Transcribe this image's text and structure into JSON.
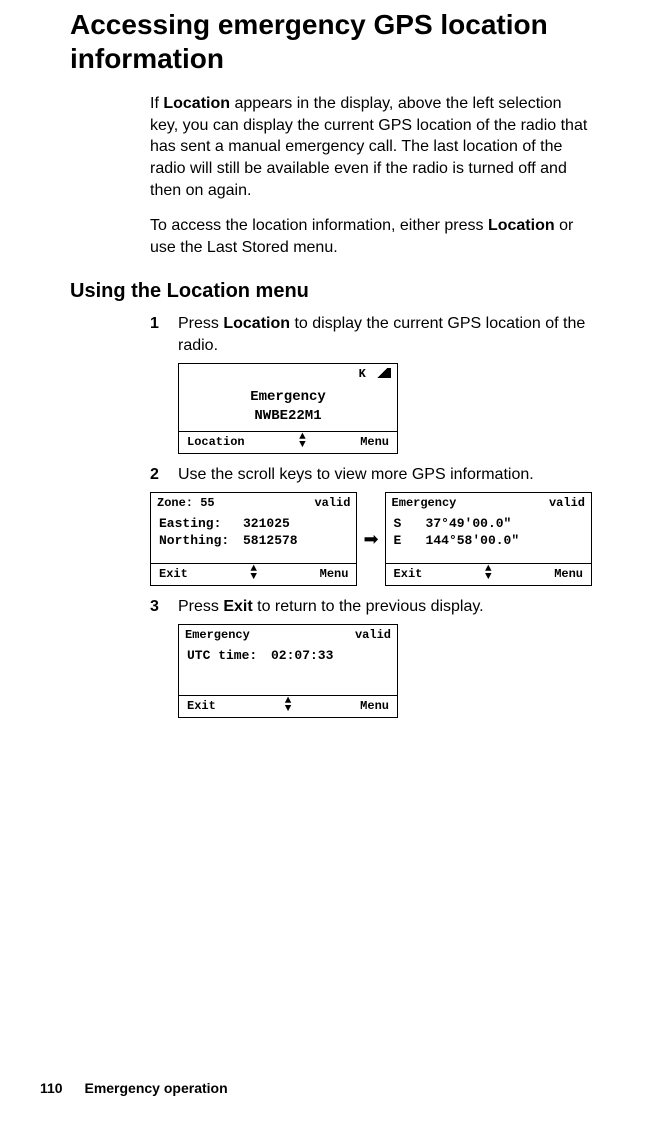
{
  "title": "Accessing emergency GPS location information",
  "intro_p1_pre": "If ",
  "intro_p1_bold": "Location",
  "intro_p1_post": " appears in the display, above the left selection key, you can display the current GPS location of the radio that has sent a manual emergency call. The last location of the radio will still be available even if the radio is turned off and then on again.",
  "intro_p2_pre": "To access the location information, either press ",
  "intro_p2_bold": "Location",
  "intro_p2_post": " or use the Last Stored menu.",
  "subheading": "Using the Location menu",
  "steps": {
    "s1": {
      "num": "1",
      "pre": "Press ",
      "bold": "Location",
      "post": " to display the current GPS location of the radio."
    },
    "s2": {
      "num": "2",
      "text": "Use the scroll keys to view more GPS information."
    },
    "s3": {
      "num": "3",
      "pre": "Press ",
      "bold": "Exit",
      "post": " to return to the previous display."
    }
  },
  "screens": {
    "main": {
      "status_letter": "K",
      "line1": "Emergency",
      "line2": "NWBE22M1",
      "soft_left": "Location",
      "soft_right": "Menu"
    },
    "zone": {
      "header_left": "Zone: 55",
      "header_right": "valid",
      "easting_label": "Easting:",
      "easting_value": "321025",
      "northing_label": "Northing:",
      "northing_value": "5812578",
      "soft_left": "Exit",
      "soft_right": "Menu"
    },
    "latlon": {
      "header_left": "Emergency",
      "header_right": "valid",
      "lat_dir": "S",
      "lat_val": "37°49'00.0\"",
      "lon_dir": "E",
      "lon_val": "144°58'00.0\"",
      "soft_left": "Exit",
      "soft_right": "Menu"
    },
    "utc": {
      "header_left": "Emergency",
      "header_right": "valid",
      "utc_label": "UTC time:",
      "utc_value": "02:07:33",
      "soft_left": "Exit",
      "soft_right": "Menu"
    }
  },
  "footer": {
    "page": "110",
    "section": "Emergency operation"
  }
}
